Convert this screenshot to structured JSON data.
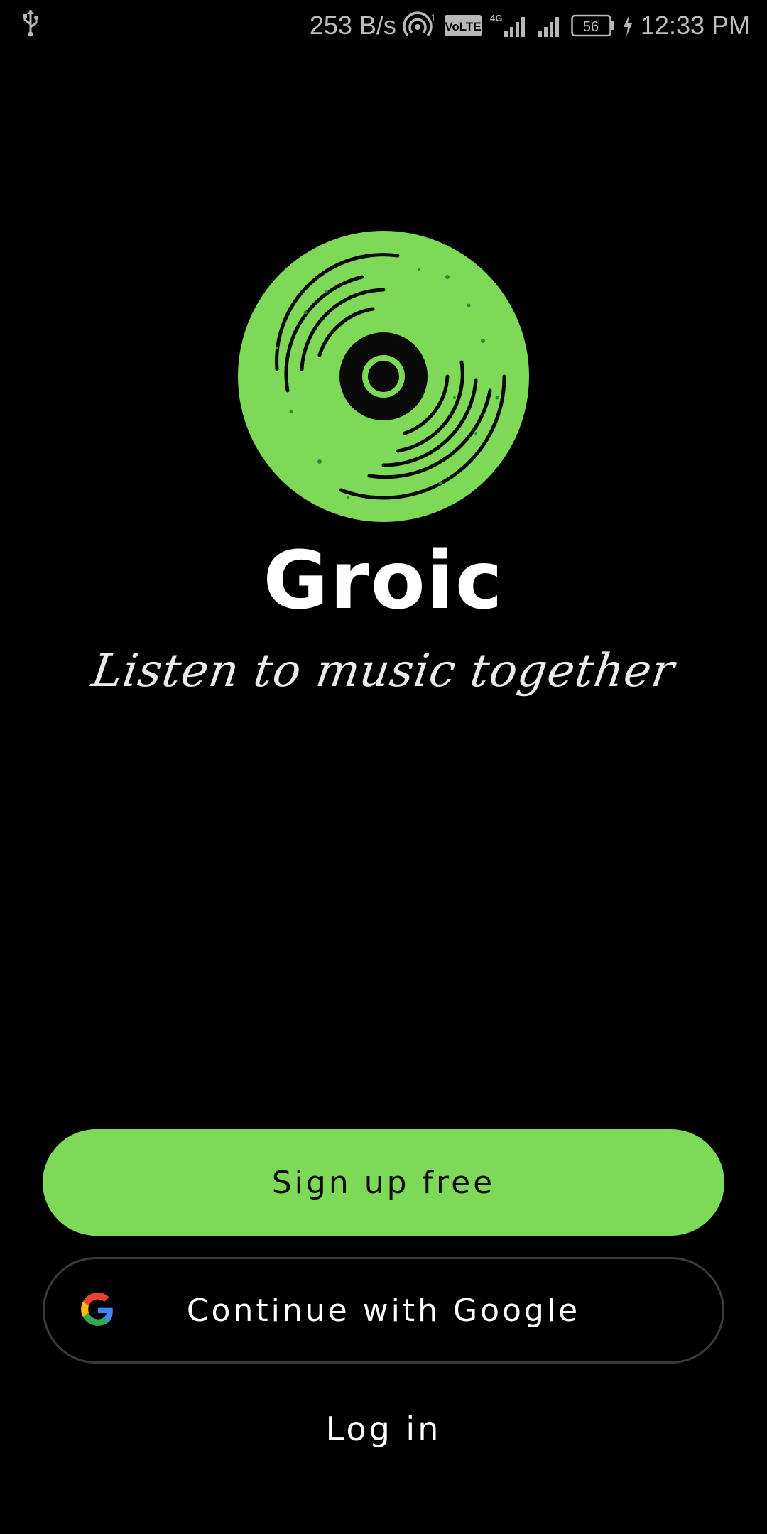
{
  "status_bar": {
    "network_speed": "253 B/s",
    "hotspot_badge": "1",
    "volte_label": "VoLTE",
    "network_type": "4G",
    "battery_level": "56",
    "time": "12:33 PM"
  },
  "app": {
    "name": "Groic",
    "tagline": "Listen to music together",
    "accent_color": "#7ed957"
  },
  "actions": {
    "signup_label": "Sign up free",
    "google_label": "Continue with Google",
    "login_label": "Log in"
  },
  "icons": {
    "usb": "usb-icon",
    "hotspot": "hotspot-icon",
    "signal": "signal-icon",
    "battery": "battery-icon",
    "charging": "charging-bolt-icon",
    "logo": "vinyl-disc-logo",
    "google": "google-g-icon"
  }
}
